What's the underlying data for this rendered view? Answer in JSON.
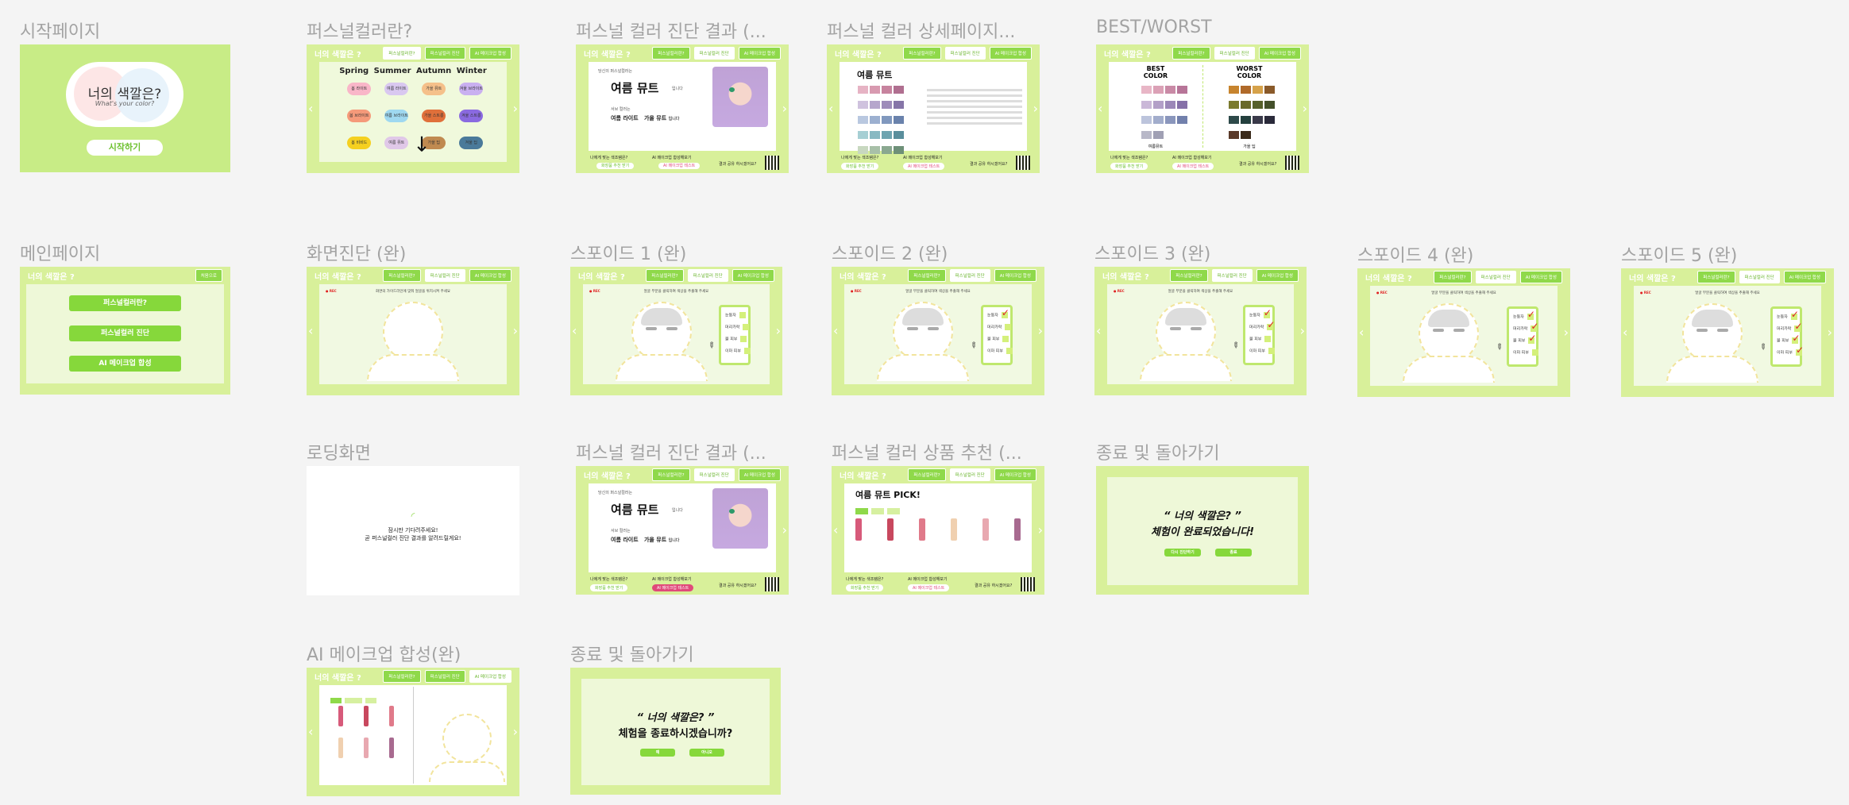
{
  "app_title": "너의 색깔은 ?",
  "top_buttons": [
    "퍼스널컬러란?",
    "퍼스널컬러 진단",
    "AI 메이크업 합성"
  ],
  "frames": {
    "start": {
      "label": "시작페이지",
      "logo_text": "너의 색깔은?",
      "logo_sub": "What's your color?",
      "start_button": "시작하기"
    },
    "intro": {
      "label": "퍼스널컬러란?",
      "seasons": [
        "Spring",
        "Summer",
        "Autumn",
        "Winter"
      ],
      "tones": [
        [
          "봄 라이트",
          "여름 라이트",
          "가을 뮤트",
          "겨울 브라이트"
        ],
        [
          "봄 브라이트",
          "여름 브라이트",
          "가을 스트롱",
          "겨울 스트롱"
        ],
        [
          "봄 비비드",
          "여름 뮤트",
          "가을 딥",
          "겨울 딥"
        ]
      ]
    },
    "result1": {
      "label": "퍼스널 컬러 진단 결과 (...",
      "sub_label": "당신의 퍼스널컬러는",
      "tone": "여름 뮤트",
      "tone_suffix": "입니다",
      "second_label": "서브 컬러는",
      "subtones": [
        "여름 라이트",
        "가을 뮤트"
      ],
      "subtones_suffix": "입니다",
      "q1": "나에게 맞는 색조템은?",
      "q2": "AI 메이크업 합성해보기",
      "b1": "화장품 추천 받기",
      "b2": "AI 메이크업 테스트",
      "share": "결과 공유 하시겠어요?"
    },
    "detail": {
      "label": "퍼스널 컬러 상세페이지...",
      "tone": "여름 뮤트",
      "q1": "나에게 맞는 색조템은?",
      "q2": "AI 메이크업 합성해보기",
      "b1": "화장품 추천 받기",
      "b2": "AI 메이크업 테스트",
      "share": "결과 공유 하시겠어요?"
    },
    "bestworst": {
      "label": "BEST/WORST",
      "best": "BEST\nCOLOR",
      "worst": "WORST\nCOLOR",
      "best_cap": "여름뮤트",
      "worst_cap": "가을 딥",
      "q1": "나에게 맞는 색조템은?",
      "q2": "AI 메이크업 합성해보기",
      "b1": "화장품 추천 받기",
      "b2": "AI 메이크업 테스트",
      "share": "결과 공유 하시겠어요?"
    },
    "main": {
      "label": "메인페이지",
      "home_btn": "처음으로",
      "buttons": [
        "퍼스널컬러란?",
        "퍼스널컬러 진단",
        "AI 메이크업 합성"
      ]
    },
    "screen": {
      "label": "화면진단 (완)",
      "guide": "화면의 가이드라인에 맞춰 얼굴을 위치시켜 주세요"
    },
    "sp1": {
      "label": "스포이드 1 (완)",
      "guide": "얼굴 부분을 클릭하여 색상을 추출해 주세요"
    },
    "sp2": {
      "label": "스포이드 2 (완)",
      "guide": "얼굴 부분을 클릭하여 색상을 추출해 주세요"
    },
    "sp3": {
      "label": "스포이드 3 (완)",
      "guide": "얼굴 부분을 클릭하여 색상을 추출해 주세요"
    },
    "sp4": {
      "label": "스포이드 4 (완)",
      "guide": "얼굴 부분을 클릭하여 색상을 추출해 주세요"
    },
    "sp5": {
      "label": "스포이드 5 (완)",
      "guide": "얼굴 부분을 클릭하여 색상을 추출해 주세요"
    },
    "checks": [
      "눈동자",
      "머리카락",
      "볼 피부",
      "이마 피부"
    ],
    "loading": {
      "label": "로딩화면",
      "line1": "잠시만 기다려주세요!",
      "line2": "곧 퍼스널컬러 진단 결과를 알려드릴게요!"
    },
    "result2": {
      "label": "퍼스널 컬러 진단 결과 (...",
      "sub_label": "당신의 퍼스널컬러는",
      "tone": "여름 뮤트",
      "tone_suffix": "입니다",
      "second_label": "서브 컬러는",
      "subtones": [
        "여름 라이트",
        "가을 뮤트"
      ],
      "subtones_suffix": "입니다",
      "q1": "나에게 맞는 색조템은?",
      "q2": "AI 메이크업 합성해보기",
      "b1": "화장품 추천 받기",
      "b2": "AI 메이크업 테스트",
      "share": "결과 공유 하시겠어요?"
    },
    "products": {
      "label": "퍼스널 컬러 상품 추천 (...",
      "title": "여름 뮤트 PICK!",
      "q1": "나에게 맞는 색조템은?",
      "q2": "AI 메이크업 합성해보기",
      "b1": "화장품 추천 받기",
      "b2": "AI 메이크업 테스트",
      "share": "결과 공유 하시겠어요?"
    },
    "end1": {
      "label": "종료 및 돌아가기",
      "quote": "“ 너의 색깔은? ”",
      "msg": "체험이 완료되었습니다!",
      "b1": "다시 진단하기",
      "b2": "종료"
    },
    "ai": {
      "label": "AI 메이크업 합성(완)"
    },
    "end2": {
      "label": "종료 및 돌아가기",
      "quote": "“ 너의 색깔은? ”",
      "msg": "체험을 종료하시겠습니까?",
      "b1": "예",
      "b2": "아니오"
    }
  }
}
